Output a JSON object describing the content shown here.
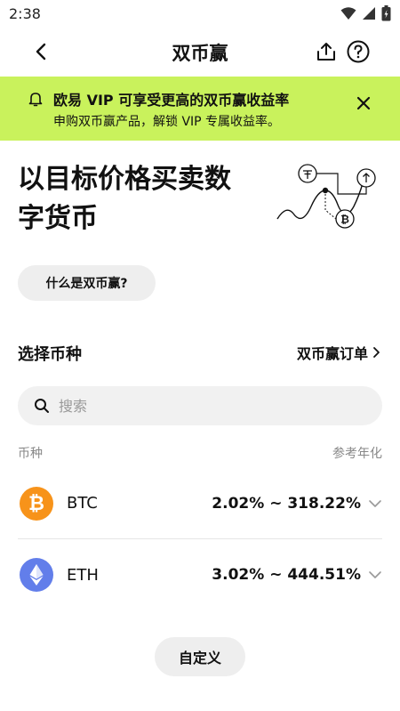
{
  "status_bar": {
    "time": "2:38"
  },
  "nav": {
    "title": "双币赢"
  },
  "banner": {
    "title": "欧易 VIP 可享受更高的双币赢收益率",
    "subtitle": "申购双币赢产品，解锁 VIP 专属收益率。",
    "bg_color": "#c9f25c"
  },
  "hero": {
    "title": "以目标价格买卖数字货币"
  },
  "what_is_button": "什么是双币赢?",
  "select_coin": {
    "heading": "选择币种",
    "orders_link": "双币赢订单"
  },
  "search": {
    "placeholder": "搜索"
  },
  "list": {
    "col_coin": "币种",
    "col_apr": "参考年化",
    "items": [
      {
        "symbol": "BTC",
        "rate": "2.02% ~ 318.22%",
        "logo_color": "#f7931a",
        "icon": "bitcoin-icon"
      },
      {
        "symbol": "ETH",
        "rate": "3.02% ~ 444.51%",
        "logo_color": "#627eea",
        "icon": "ethereum-icon"
      }
    ]
  },
  "custom_button": "自定义"
}
